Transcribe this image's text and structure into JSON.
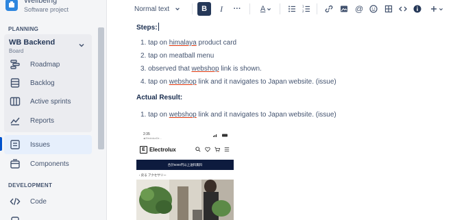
{
  "project": {
    "name": "Wellbeing",
    "type": "Software project"
  },
  "sidebar": {
    "planning_header": "PLANNING",
    "board": {
      "title": "WB Backend",
      "subtitle": "Board"
    },
    "board_items": [
      {
        "label": "Roadmap",
        "icon": "roadmap-icon"
      },
      {
        "label": "Backlog",
        "icon": "backlog-icon"
      },
      {
        "label": "Active sprints",
        "icon": "active-sprints-icon"
      },
      {
        "label": "Reports",
        "icon": "reports-icon"
      }
    ],
    "issues": {
      "label": "Issues",
      "icon": "issues-icon"
    },
    "components": {
      "label": "Components",
      "icon": "components-icon"
    },
    "development_header": "DEVELOPMENT",
    "code": {
      "label": "Code",
      "icon": "code-icon"
    }
  },
  "toolbar": {
    "text_style": "Normal text",
    "bold": "B",
    "italic": "I",
    "more": "···",
    "text_color": "A"
  },
  "editor": {
    "steps_heading": "Steps:",
    "steps": [
      {
        "num": "1.",
        "pre": "tap on ",
        "flag": "himalaya",
        "post": " product card"
      },
      {
        "num": "2.",
        "pre": "tap on meatball menu",
        "flag": "",
        "post": ""
      },
      {
        "num": "3.",
        "pre": "observed that ",
        "flag": "webshop",
        "post": " link is shown."
      },
      {
        "num": "4.",
        "pre": "tap on ",
        "flag": "webshop",
        "post": " link and it navigates to Japan website. (issue)"
      }
    ],
    "actual_heading": "Actual Result:",
    "actual": [
      {
        "num": "1.",
        "pre": "tap on ",
        "flag": "webshop",
        "post": " link and it navigates to Japan website. (issue)"
      }
    ]
  },
  "phone_screenshot": {
    "time": "2:35",
    "carrier": "◀ ElectroluxDe…",
    "brand": "Electrolux",
    "banner": "合計5000円以上送料無料",
    "back": "戻る アクセサリー"
  },
  "colors": {
    "accent": "#0052cc",
    "sidebar_bg": "#f4f5f7",
    "active_bg": "#e6effc",
    "spellcheck": "#de350b"
  }
}
